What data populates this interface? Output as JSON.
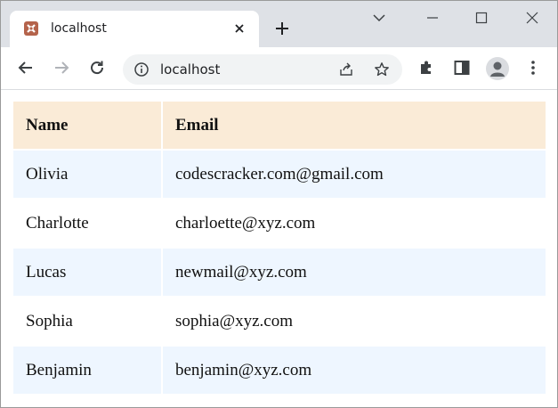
{
  "browser": {
    "tab_title": "localhost",
    "address": "localhost"
  },
  "table": {
    "headers": [
      "Name",
      "Email"
    ],
    "rows": [
      {
        "name": "Olivia",
        "email": "codescracker.com@gmail.com"
      },
      {
        "name": "Charlotte",
        "email": "charloette@xyz.com"
      },
      {
        "name": "Lucas",
        "email": "newmail@xyz.com"
      },
      {
        "name": "Sophia",
        "email": "sophia@xyz.com"
      },
      {
        "name": "Benjamin",
        "email": "benjamin@xyz.com"
      }
    ]
  },
  "colors": {
    "header_bg": "#faebd7",
    "odd_row_bg": "#eef6ff",
    "even_row_bg": "#ffffff"
  }
}
